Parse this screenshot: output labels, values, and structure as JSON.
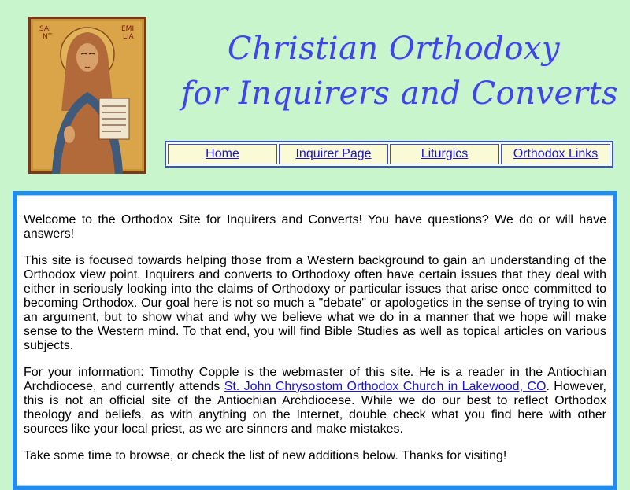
{
  "header": {
    "icon_text": {
      "left": "SAI NT",
      "right": "EMI LIA",
      "scroll": "Behold I and the children whom God has given me"
    },
    "title_line1": "Christian Orthodoxy",
    "title_line2": "for Inquirers and Converts"
  },
  "nav": {
    "items": [
      {
        "label": "Home"
      },
      {
        "label": "Inquirer Page"
      },
      {
        "label": "Liturgics"
      },
      {
        "label": "Orthodox Links"
      }
    ]
  },
  "main": {
    "para1": "Welcome to the Orthodox Site for Inquirers and Converts! You have questions? We do or will have answers!",
    "para2": "This site is focused towards helping those from a Western background to gain an understanding of the Orthodox view point. Inquirers and converts to Orthodoxy often have certain issues that they deal with either in seriously looking into the claims of Orthodoxy or particular issues that arise once committed to becoming Orthodox. Our goal here is not so much a \"debate\" or apologetics in the sense of trying to win an argument, but to show what and why we believe what we do in a manner that we hope will make sense to the Western mind. To that end, you will find Bible Studies as well as topical articles on various subjects.",
    "para3_before": "For your information: Timothy Copple is the webmaster of this site. He is a reader in the Antiochian Archdiocese, and currently attends ",
    "para3_link": "St. John Chrysostom Orthodox Church in Lakewood, CO",
    "para3_after": ". However, this is not an official site of the Antiochian Archdiocese. While we do our best to reflect Orthodox theology and beliefs, as with anything on the Internet, double check what you find here with other sources like your local priest, as we are sinners and make mistakes.",
    "para4": "Take some time to browse, or check the list of new additions below. Thanks for visiting!"
  }
}
